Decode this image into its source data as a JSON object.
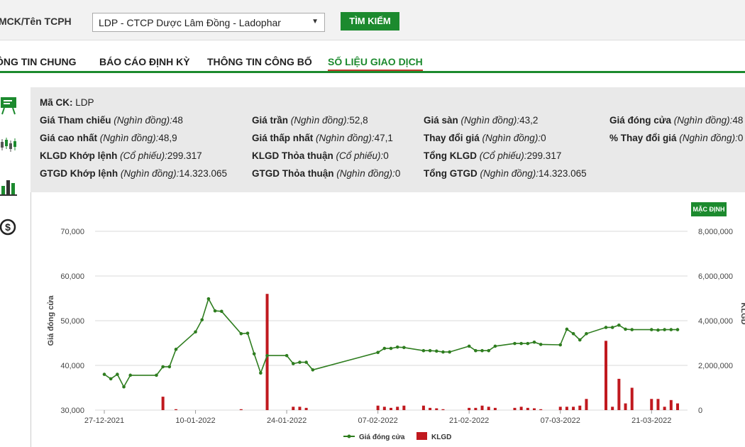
{
  "search": {
    "label": "MCK/Tên TCPH",
    "selected": "LDP - CTCP Dược Lâm Đồng - Ladophar",
    "button": "TÌM KIẾM"
  },
  "tabs": [
    {
      "label": "ÔNG TIN CHUNG",
      "active": false
    },
    {
      "label": "BÁO CÁO ĐỊNH KỲ",
      "active": false
    },
    {
      "label": "THÔNG TIN CÔNG BỐ",
      "active": false
    },
    {
      "label": "SỐ LIỆU GIAO DỊCH",
      "active": true
    }
  ],
  "side_icons": [
    "board-icon",
    "candlestick-icon",
    "bar-chart-icon",
    "dollar-icon"
  ],
  "info": {
    "ma_ck": {
      "label": "Mã CK:",
      "value": "LDP"
    },
    "rows": [
      [
        {
          "label": "Giá Tham chiếu",
          "unit": "(Nghìn đồng):",
          "value": "48"
        },
        {
          "label": "Giá trần",
          "unit": "(Nghìn đồng):",
          "value": "52,8"
        },
        {
          "label": "Giá sàn",
          "unit": "(Nghìn đồng):",
          "value": "43,2"
        },
        {
          "label": "Giá đóng cửa",
          "unit": "(Nghìn đồng):",
          "value": "48"
        }
      ],
      [
        {
          "label": "Giá cao nhất",
          "unit": "(Nghìn đồng):",
          "value": "48,9"
        },
        {
          "label": "Giá thấp nhất",
          "unit": "(Nghìn đồng):",
          "value": "47,1"
        },
        {
          "label": "Thay đổi giá",
          "unit": "(Nghìn đồng):",
          "value": "0"
        },
        {
          "label": "% Thay đổi giá",
          "unit": "(Nghìn đồng):",
          "value": "0"
        }
      ],
      [
        {
          "label": "KLGD Khớp lệnh",
          "unit": "(Cổ phiếu):",
          "value": "299.317"
        },
        {
          "label": "KLGD Thỏa thuận",
          "unit": "(Cổ phiếu):",
          "value": "0"
        },
        {
          "label": "Tổng KLGD",
          "unit": "(Cổ phiếu):",
          "value": "299.317"
        }
      ],
      [
        {
          "label": "GTGD Khớp lệnh",
          "unit": "(Nghìn đồng):",
          "value": "14.323.065"
        },
        {
          "label": "GTGD Thỏa thuận",
          "unit": "(Nghìn đồng):",
          "value": "0"
        },
        {
          "label": "Tổng GTGD",
          "unit": "(Nghìn đồng):",
          "value": "14.323.065"
        }
      ]
    ]
  },
  "chart_button": "MẶC ĐỊNH",
  "colors": {
    "accent": "#1c8a2e",
    "price_line": "#2e7d1f",
    "volume_bar": "#c0191f",
    "active_tab_underline": "#c0392b"
  },
  "chart_data": {
    "type": "line",
    "left_axis_label": "Giá đóng cửa",
    "right_axis_label": "KLGD",
    "ylim_left": [
      30000,
      70000
    ],
    "ylim_right": [
      0,
      8000000
    ],
    "yticks_left": [
      "70,000",
      "60,000",
      "50,000",
      "40,000",
      "30,000"
    ],
    "yticks_right": [
      "8,000,000",
      "6,000,000",
      "4,000,000",
      "2,000,000",
      "0"
    ],
    "xticks": [
      "27-12-2021",
      "10-01-2022",
      "24-01-2022",
      "07-02-2022",
      "21-02-2022",
      "07-03-2022",
      "21-03-2022"
    ],
    "legend": [
      "Giá đóng cửa",
      "KLGD"
    ],
    "series": [
      {
        "name": "Giá đóng cửa",
        "points": [
          [
            "2021-12-27",
            38000
          ],
          [
            "2021-12-28",
            37000
          ],
          [
            "2021-12-29",
            38000
          ],
          [
            "2021-12-30",
            35200
          ],
          [
            "2021-12-31",
            37800
          ],
          [
            "2022-01-04",
            37800
          ],
          [
            "2022-01-05",
            39700
          ],
          [
            "2022-01-06",
            39700
          ],
          [
            "2022-01-07",
            43600
          ],
          [
            "2022-01-10",
            47500
          ],
          [
            "2022-01-11",
            50200
          ],
          [
            "2022-01-12",
            54900
          ],
          [
            "2022-01-13",
            52200
          ],
          [
            "2022-01-14",
            52100
          ],
          [
            "2022-01-17",
            47100
          ],
          [
            "2022-01-18",
            47200
          ],
          [
            "2022-01-19",
            42600
          ],
          [
            "2022-01-20",
            38300
          ],
          [
            "2022-01-21",
            42200
          ],
          [
            "2022-01-24",
            42200
          ],
          [
            "2022-01-25",
            40400
          ],
          [
            "2022-01-26",
            40700
          ],
          [
            "2022-01-27",
            40700
          ],
          [
            "2022-01-28",
            39000
          ],
          [
            "2022-02-07",
            42900
          ],
          [
            "2022-02-08",
            43800
          ],
          [
            "2022-02-09",
            43800
          ],
          [
            "2022-02-10",
            44100
          ],
          [
            "2022-02-11",
            44000
          ],
          [
            "2022-02-14",
            43300
          ],
          [
            "2022-02-15",
            43300
          ],
          [
            "2022-02-16",
            43200
          ],
          [
            "2022-02-17",
            43000
          ],
          [
            "2022-02-18",
            43000
          ],
          [
            "2022-02-21",
            44300
          ],
          [
            "2022-02-22",
            43300
          ],
          [
            "2022-02-23",
            43300
          ],
          [
            "2022-02-24",
            43300
          ],
          [
            "2022-02-25",
            44300
          ],
          [
            "2022-02-28",
            44900
          ],
          [
            "2022-03-01",
            44900
          ],
          [
            "2022-03-02",
            44900
          ],
          [
            "2022-03-03",
            45200
          ],
          [
            "2022-03-04",
            44700
          ],
          [
            "2022-03-07",
            44600
          ],
          [
            "2022-03-08",
            48100
          ],
          [
            "2022-03-09",
            47100
          ],
          [
            "2022-03-10",
            45700
          ],
          [
            "2022-03-11",
            47100
          ],
          [
            "2022-03-14",
            48500
          ],
          [
            "2022-03-15",
            48500
          ],
          [
            "2022-03-16",
            49000
          ],
          [
            "2022-03-17",
            48100
          ],
          [
            "2022-03-18",
            48000
          ],
          [
            "2022-03-21",
            48000
          ],
          [
            "2022-03-22",
            47900
          ],
          [
            "2022-03-23",
            48000
          ],
          [
            "2022-03-24",
            48000
          ],
          [
            "2022-03-25",
            48000
          ]
        ]
      },
      {
        "name": "KLGD",
        "points": [
          [
            "2021-12-27",
            0
          ],
          [
            "2021-12-28",
            0
          ],
          [
            "2021-12-29",
            0
          ],
          [
            "2021-12-30",
            0
          ],
          [
            "2021-12-31",
            0
          ],
          [
            "2022-01-04",
            0
          ],
          [
            "2022-01-05",
            600000
          ],
          [
            "2022-01-06",
            0
          ],
          [
            "2022-01-07",
            40000
          ],
          [
            "2022-01-10",
            0
          ],
          [
            "2022-01-11",
            0
          ],
          [
            "2022-01-12",
            0
          ],
          [
            "2022-01-13",
            0
          ],
          [
            "2022-01-14",
            0
          ],
          [
            "2022-01-17",
            40000
          ],
          [
            "2022-01-18",
            0
          ],
          [
            "2022-01-19",
            0
          ],
          [
            "2022-01-20",
            0
          ],
          [
            "2022-01-21",
            5200000
          ],
          [
            "2022-01-24",
            0
          ],
          [
            "2022-01-25",
            150000
          ],
          [
            "2022-01-26",
            150000
          ],
          [
            "2022-01-27",
            100000
          ],
          [
            "2022-01-28",
            0
          ],
          [
            "2022-02-07",
            200000
          ],
          [
            "2022-02-08",
            150000
          ],
          [
            "2022-02-09",
            100000
          ],
          [
            "2022-02-10",
            150000
          ],
          [
            "2022-02-11",
            200000
          ],
          [
            "2022-02-14",
            200000
          ],
          [
            "2022-02-15",
            100000
          ],
          [
            "2022-02-16",
            80000
          ],
          [
            "2022-02-17",
            40000
          ],
          [
            "2022-02-18",
            0
          ],
          [
            "2022-02-21",
            100000
          ],
          [
            "2022-02-22",
            100000
          ],
          [
            "2022-02-23",
            200000
          ],
          [
            "2022-02-24",
            150000
          ],
          [
            "2022-02-25",
            100000
          ],
          [
            "2022-02-28",
            100000
          ],
          [
            "2022-03-01",
            150000
          ],
          [
            "2022-03-02",
            100000
          ],
          [
            "2022-03-03",
            80000
          ],
          [
            "2022-03-04",
            40000
          ],
          [
            "2022-03-07",
            150000
          ],
          [
            "2022-03-08",
            150000
          ],
          [
            "2022-03-09",
            150000
          ],
          [
            "2022-03-10",
            200000
          ],
          [
            "2022-03-11",
            500000
          ],
          [
            "2022-03-14",
            3100000
          ],
          [
            "2022-03-15",
            150000
          ],
          [
            "2022-03-16",
            1400000
          ],
          [
            "2022-03-17",
            300000
          ],
          [
            "2022-03-18",
            1000000
          ],
          [
            "2022-03-21",
            500000
          ],
          [
            "2022-03-22",
            500000
          ],
          [
            "2022-03-23",
            150000
          ],
          [
            "2022-03-24",
            450000
          ],
          [
            "2022-03-25",
            300000
          ]
        ]
      }
    ]
  }
}
